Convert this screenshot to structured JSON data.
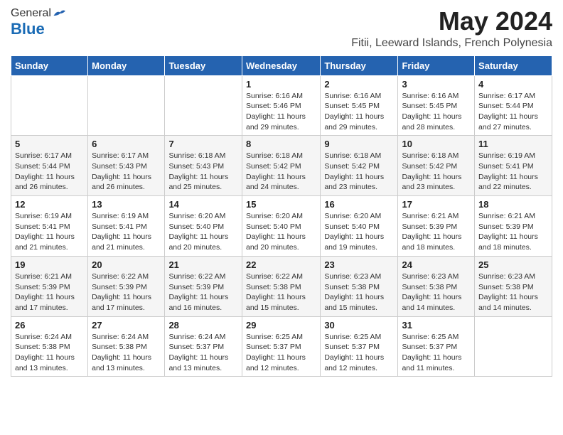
{
  "header": {
    "logo_general": "General",
    "logo_blue": "Blue",
    "title": "May 2024",
    "location": "Fitii, Leeward Islands, French Polynesia"
  },
  "days_of_week": [
    "Sunday",
    "Monday",
    "Tuesday",
    "Wednesday",
    "Thursday",
    "Friday",
    "Saturday"
  ],
  "weeks": [
    [
      {
        "day": "",
        "info": ""
      },
      {
        "day": "",
        "info": ""
      },
      {
        "day": "",
        "info": ""
      },
      {
        "day": "1",
        "info": "Sunrise: 6:16 AM\nSunset: 5:46 PM\nDaylight: 11 hours and 29 minutes."
      },
      {
        "day": "2",
        "info": "Sunrise: 6:16 AM\nSunset: 5:45 PM\nDaylight: 11 hours and 29 minutes."
      },
      {
        "day": "3",
        "info": "Sunrise: 6:16 AM\nSunset: 5:45 PM\nDaylight: 11 hours and 28 minutes."
      },
      {
        "day": "4",
        "info": "Sunrise: 6:17 AM\nSunset: 5:44 PM\nDaylight: 11 hours and 27 minutes."
      }
    ],
    [
      {
        "day": "5",
        "info": "Sunrise: 6:17 AM\nSunset: 5:44 PM\nDaylight: 11 hours and 26 minutes."
      },
      {
        "day": "6",
        "info": "Sunrise: 6:17 AM\nSunset: 5:43 PM\nDaylight: 11 hours and 26 minutes."
      },
      {
        "day": "7",
        "info": "Sunrise: 6:18 AM\nSunset: 5:43 PM\nDaylight: 11 hours and 25 minutes."
      },
      {
        "day": "8",
        "info": "Sunrise: 6:18 AM\nSunset: 5:42 PM\nDaylight: 11 hours and 24 minutes."
      },
      {
        "day": "9",
        "info": "Sunrise: 6:18 AM\nSunset: 5:42 PM\nDaylight: 11 hours and 23 minutes."
      },
      {
        "day": "10",
        "info": "Sunrise: 6:18 AM\nSunset: 5:42 PM\nDaylight: 11 hours and 23 minutes."
      },
      {
        "day": "11",
        "info": "Sunrise: 6:19 AM\nSunset: 5:41 PM\nDaylight: 11 hours and 22 minutes."
      }
    ],
    [
      {
        "day": "12",
        "info": "Sunrise: 6:19 AM\nSunset: 5:41 PM\nDaylight: 11 hours and 21 minutes."
      },
      {
        "day": "13",
        "info": "Sunrise: 6:19 AM\nSunset: 5:41 PM\nDaylight: 11 hours and 21 minutes."
      },
      {
        "day": "14",
        "info": "Sunrise: 6:20 AM\nSunset: 5:40 PM\nDaylight: 11 hours and 20 minutes."
      },
      {
        "day": "15",
        "info": "Sunrise: 6:20 AM\nSunset: 5:40 PM\nDaylight: 11 hours and 20 minutes."
      },
      {
        "day": "16",
        "info": "Sunrise: 6:20 AM\nSunset: 5:40 PM\nDaylight: 11 hours and 19 minutes."
      },
      {
        "day": "17",
        "info": "Sunrise: 6:21 AM\nSunset: 5:39 PM\nDaylight: 11 hours and 18 minutes."
      },
      {
        "day": "18",
        "info": "Sunrise: 6:21 AM\nSunset: 5:39 PM\nDaylight: 11 hours and 18 minutes."
      }
    ],
    [
      {
        "day": "19",
        "info": "Sunrise: 6:21 AM\nSunset: 5:39 PM\nDaylight: 11 hours and 17 minutes."
      },
      {
        "day": "20",
        "info": "Sunrise: 6:22 AM\nSunset: 5:39 PM\nDaylight: 11 hours and 17 minutes."
      },
      {
        "day": "21",
        "info": "Sunrise: 6:22 AM\nSunset: 5:39 PM\nDaylight: 11 hours and 16 minutes."
      },
      {
        "day": "22",
        "info": "Sunrise: 6:22 AM\nSunset: 5:38 PM\nDaylight: 11 hours and 15 minutes."
      },
      {
        "day": "23",
        "info": "Sunrise: 6:23 AM\nSunset: 5:38 PM\nDaylight: 11 hours and 15 minutes."
      },
      {
        "day": "24",
        "info": "Sunrise: 6:23 AM\nSunset: 5:38 PM\nDaylight: 11 hours and 14 minutes."
      },
      {
        "day": "25",
        "info": "Sunrise: 6:23 AM\nSunset: 5:38 PM\nDaylight: 11 hours and 14 minutes."
      }
    ],
    [
      {
        "day": "26",
        "info": "Sunrise: 6:24 AM\nSunset: 5:38 PM\nDaylight: 11 hours and 13 minutes."
      },
      {
        "day": "27",
        "info": "Sunrise: 6:24 AM\nSunset: 5:38 PM\nDaylight: 11 hours and 13 minutes."
      },
      {
        "day": "28",
        "info": "Sunrise: 6:24 AM\nSunset: 5:37 PM\nDaylight: 11 hours and 13 minutes."
      },
      {
        "day": "29",
        "info": "Sunrise: 6:25 AM\nSunset: 5:37 PM\nDaylight: 11 hours and 12 minutes."
      },
      {
        "day": "30",
        "info": "Sunrise: 6:25 AM\nSunset: 5:37 PM\nDaylight: 11 hours and 12 minutes."
      },
      {
        "day": "31",
        "info": "Sunrise: 6:25 AM\nSunset: 5:37 PM\nDaylight: 11 hours and 11 minutes."
      },
      {
        "day": "",
        "info": ""
      }
    ]
  ]
}
